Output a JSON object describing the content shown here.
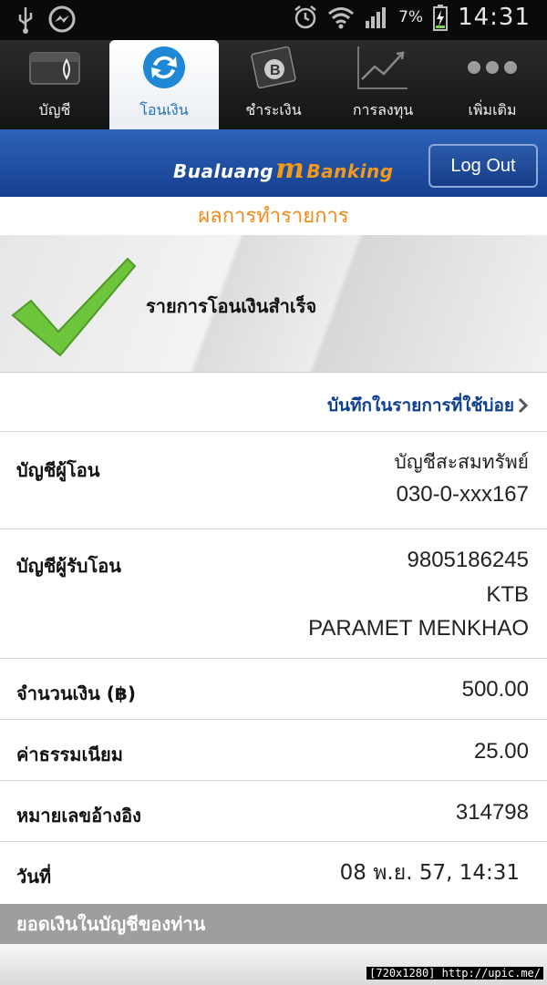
{
  "status_bar": {
    "battery_percent": "7%",
    "time": "14:31"
  },
  "tabs": [
    {
      "label": "บัญชี",
      "icon": "wallet-icon",
      "active": false
    },
    {
      "label": "โอนเงิน",
      "icon": "refresh-icon",
      "active": true
    },
    {
      "label": "ชำระเงิน",
      "icon": "bill-icon",
      "active": false
    },
    {
      "label": "การลงทุน",
      "icon": "chart-icon",
      "active": false
    },
    {
      "label": "เพิ่มเติม",
      "icon": "more-icon",
      "active": false
    }
  ],
  "header": {
    "brand_prefix": "Bualuang",
    "brand_m": "m",
    "brand_suffix": "Banking",
    "logout_label": "Log Out"
  },
  "result": {
    "title": "ผลการทำรายการ",
    "success_message": "รายการโอนเงินสำเร็จ",
    "save_favorite_label": "บันทึกในรายการที่ใช้บ่อย"
  },
  "details": {
    "from_label": "บัญชีผู้โอน",
    "from_line1": "บัญชีสะสมทรัพย์",
    "from_line2": "030-0-xxx167",
    "to_label": "บัญชีผู้รับโอน",
    "to_line1": "9805186245",
    "to_line2": "KTB",
    "to_line3": "PARAMET MENKHAO",
    "amount_label": "จำนวนเงิน (฿)",
    "amount_value": "500.00",
    "fee_label": "ค่าธรรมเนียม",
    "fee_value": "25.00",
    "ref_label": "หมายเลขอ้างอิง",
    "ref_value": "314798",
    "date_label": "วันที่",
    "date_value": "08 พ.ย. 57, 14:31"
  },
  "balance_section": {
    "title": "ยอดเงินในบัญชีของท่าน"
  },
  "watermark": "[720x1280] http://upic.me/",
  "colors": {
    "brand_blue": "#1f4fa3",
    "accent_orange": "#f08a1a",
    "success_green": "#6cc53a",
    "link_blue": "#0d3f91"
  }
}
